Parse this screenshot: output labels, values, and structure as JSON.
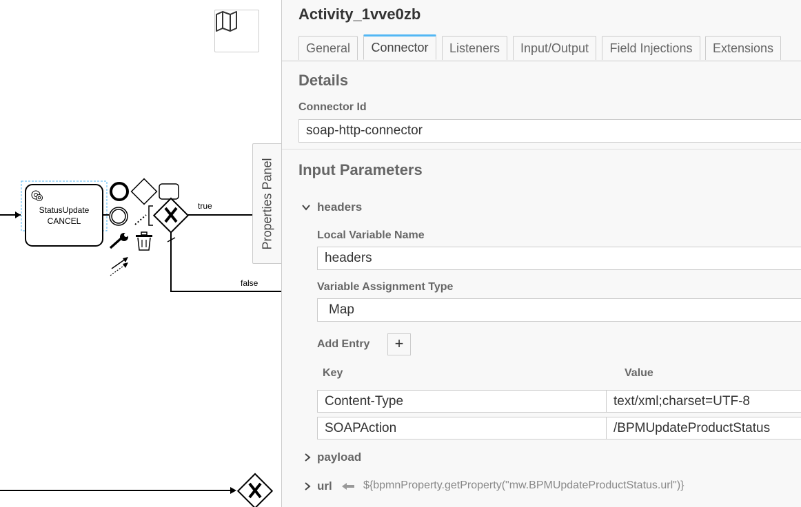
{
  "diagram": {
    "task": {
      "line1": "StatusUpdate",
      "line2": "CANCEL"
    },
    "flow_true_label": "true",
    "flow_false_label": "false"
  },
  "toggle": {
    "label": "Properties Panel"
  },
  "panel": {
    "title": "Activity_1vve0zb",
    "tabs": [
      {
        "label": "General"
      },
      {
        "label": "Connector",
        "active": true
      },
      {
        "label": "Listeners"
      },
      {
        "label": "Input/Output"
      },
      {
        "label": "Field Injections"
      },
      {
        "label": "Extensions"
      }
    ],
    "details": {
      "heading": "Details",
      "connector_id_label": "Connector Id",
      "connector_id_value": "soap-http-connector"
    },
    "input_params": {
      "heading": "Input Parameters",
      "headers": {
        "name": "headers",
        "local_variable_label": "Local Variable Name",
        "local_variable_value": "headers",
        "assignment_type_label": "Variable Assignment Type",
        "assignment_type_value": "Map",
        "add_entry_label": "Add Entry",
        "add_button": "+",
        "key_header": "Key",
        "value_header": "Value",
        "entries": [
          {
            "key": "Content-Type",
            "value": "text/xml;charset=UTF-8"
          },
          {
            "key": "SOAPAction",
            "value": "/BPMUpdateProductStatus"
          }
        ]
      },
      "payload": {
        "name": "payload"
      },
      "url": {
        "name": "url",
        "expression": "${bpmnProperty.getProperty(\"mw.BPMUpdateProductStatus.url\")}"
      }
    }
  },
  "colors": {
    "accent": "#52b7f4",
    "panel_bg": "#f8f8f8",
    "border": "#cccccc"
  }
}
